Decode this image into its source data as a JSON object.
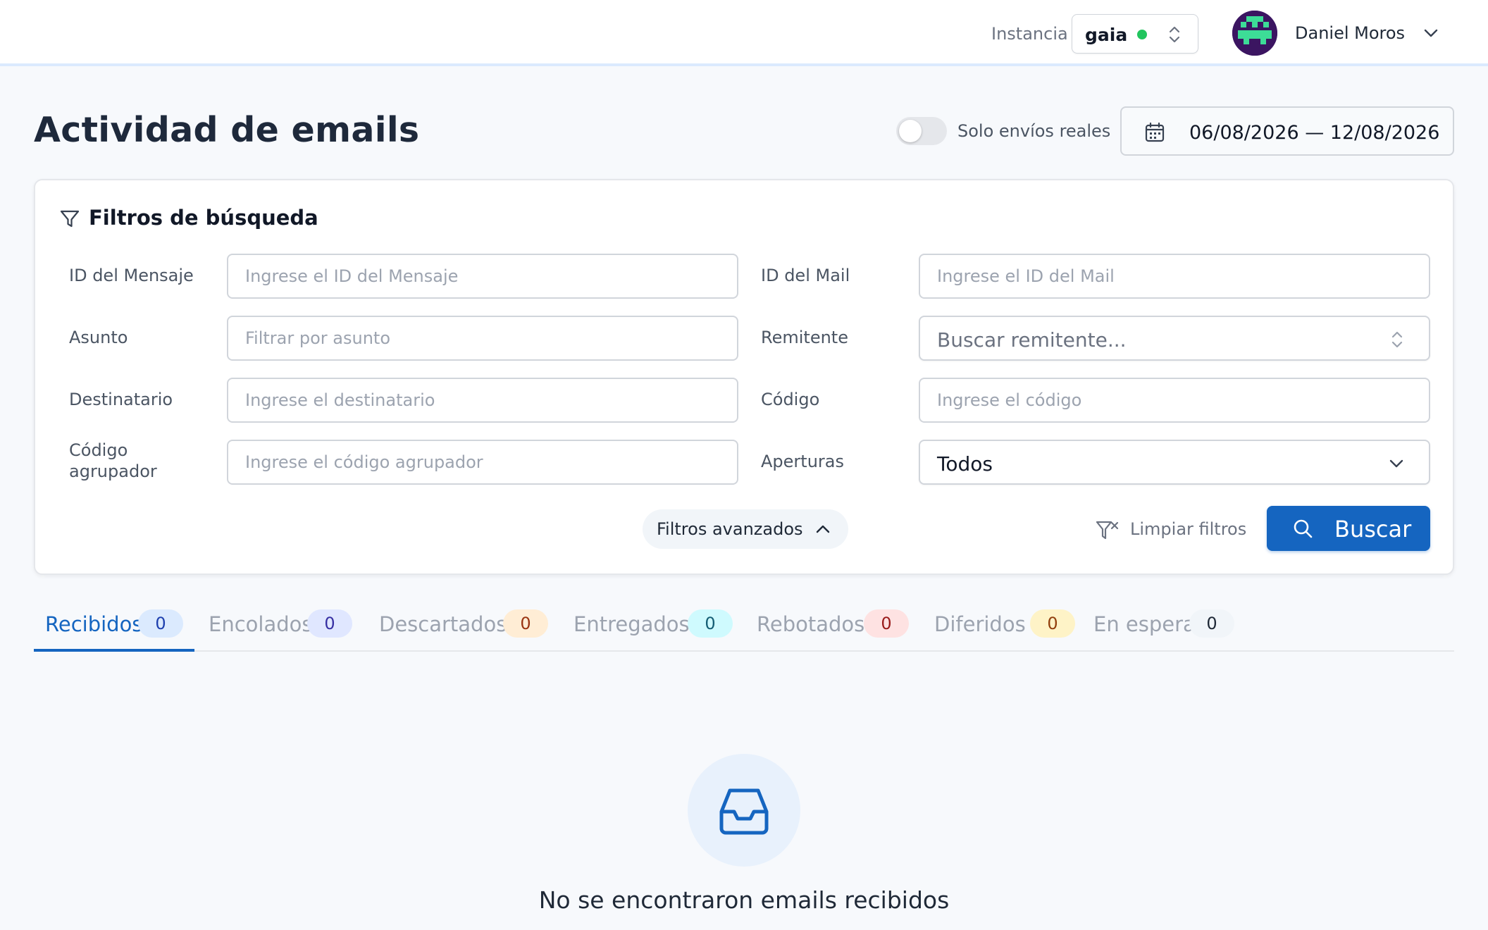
{
  "topbar": {
    "instance_label": "Instancia",
    "instance_value": "gaia",
    "instance_status_color": "#22c55e",
    "user_name": "Daniel Moros"
  },
  "header": {
    "title": "Actividad de emails",
    "toggle_label": "Solo envíos reales",
    "toggle_on": false,
    "date_range": "06/08/2026 — 12/08/2026"
  },
  "filters": {
    "title": "Filtros de búsqueda",
    "message_id": {
      "label": "ID del Mensaje",
      "placeholder": "Ingrese el ID del Mensaje",
      "value": ""
    },
    "mail_id": {
      "label": "ID del Mail",
      "placeholder": "Ingrese el ID del Mail",
      "value": ""
    },
    "subject": {
      "label": "Asunto",
      "placeholder": "Filtrar por asunto",
      "value": ""
    },
    "sender": {
      "label": "Remitente",
      "placeholder": "Buscar remitente..."
    },
    "recipient": {
      "label": "Destinatario",
      "placeholder": "Ingrese el destinatario",
      "value": ""
    },
    "code": {
      "label": "Código",
      "placeholder": "Ingrese el código",
      "value": ""
    },
    "group_code": {
      "label_line1": "Código",
      "label_line2": "agrupador",
      "placeholder": "Ingrese el código agrupador",
      "value": ""
    },
    "opens": {
      "label": "Aperturas",
      "value": "Todos"
    },
    "advanced_label": "Filtros avanzados",
    "clear_label": "Limpiar filtros",
    "search_label": "Buscar"
  },
  "tabs": [
    {
      "label": "Recibidos",
      "count": "0",
      "badge_bg": "#dbeafe",
      "badge_fg": "#1e40af",
      "active": true
    },
    {
      "label": "Encolados",
      "count": "0",
      "badge_bg": "#e0e7ff",
      "badge_fg": "#3730a3",
      "active": false
    },
    {
      "label": "Descartados",
      "count": "0",
      "badge_bg": "#ffedd5",
      "badge_fg": "#9a3412",
      "active": false
    },
    {
      "label": "Entregados",
      "count": "0",
      "badge_bg": "#cffafe",
      "badge_fg": "#155e75",
      "active": false
    },
    {
      "label": "Rebotados",
      "count": "0",
      "badge_bg": "#fee2e2",
      "badge_fg": "#991b1b",
      "active": false
    },
    {
      "label": "Diferidos",
      "count": "0",
      "badge_bg": "#fef3c7",
      "badge_fg": "#92400e",
      "active": false
    },
    {
      "label": "En espera",
      "count": "0",
      "badge_bg": "#f1f5f9",
      "badge_fg": "#1f2937",
      "active": false
    }
  ],
  "empty_state": {
    "icon": "inbox-icon",
    "title": "No se encontraron emails recibidos"
  },
  "colors": {
    "accent": "#1565c0"
  }
}
